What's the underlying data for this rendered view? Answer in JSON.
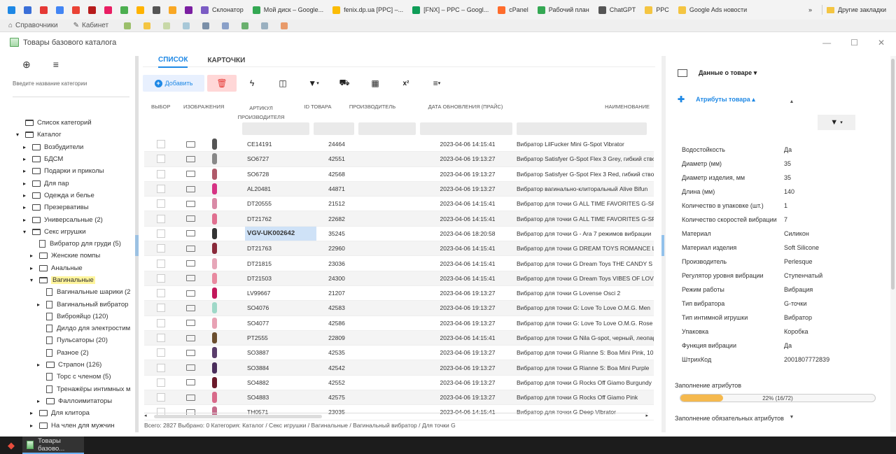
{
  "bookmarks": [
    {
      "label": "Склонатор",
      "color": "#7b5cc4"
    },
    {
      "label": "Мой диск – Google...",
      "color": "#34a853"
    },
    {
      "label": "fenix.dp.ua [PPC] –...",
      "color": "#fbbc05"
    },
    {
      "label": "[FNX] – PPC – Googl...",
      "color": "#0f9d58"
    },
    {
      "label": "cPanel",
      "color": "#ff6c2c"
    },
    {
      "label": "Рабочий план",
      "color": "#34a853"
    },
    {
      "label": "ChatGPT",
      "color": "#555555"
    },
    {
      "label": "PPC",
      "color": "#f4c542"
    },
    {
      "label": "Google Ads новости",
      "color": "#f4c542"
    }
  ],
  "bookmarks_more": "»",
  "bookmarks_other": "Другие закладки",
  "appnav": {
    "ref": "Справочники",
    "cabinet": "Кабинет"
  },
  "window_title": "Товары базового каталога",
  "left": {
    "search_placeholder": "Введите название категории",
    "tree": [
      {
        "label": "Список категорий",
        "level": 0,
        "arrow": "",
        "icon": "folder-open"
      },
      {
        "label": "Каталог",
        "level": 0,
        "arrow": "▾",
        "icon": "folder-open"
      },
      {
        "label": "Возбудители",
        "level": 1,
        "arrow": "▸",
        "icon": "folder"
      },
      {
        "label": "БДСМ",
        "level": 1,
        "arrow": "▸",
        "icon": "folder"
      },
      {
        "label": "Подарки и приколы",
        "level": 1,
        "arrow": "▸",
        "icon": "folder"
      },
      {
        "label": "Для пар",
        "level": 1,
        "arrow": "▸",
        "icon": "folder"
      },
      {
        "label": "Одежда и белье",
        "level": 1,
        "arrow": "▸",
        "icon": "folder"
      },
      {
        "label": "Презервативы",
        "level": 1,
        "arrow": "▸",
        "icon": "folder"
      },
      {
        "label": "Универсальные (2)",
        "level": 1,
        "arrow": "▸",
        "icon": "folder"
      },
      {
        "label": "Секс игрушки",
        "level": 1,
        "arrow": "▾",
        "icon": "folder-open"
      },
      {
        "label": "Вибратор для груди (5)",
        "level": 2,
        "arrow": "",
        "icon": "file"
      },
      {
        "label": "Женские помпы",
        "level": 2,
        "arrow": "▸",
        "icon": "folder"
      },
      {
        "label": "Анальные",
        "level": 2,
        "arrow": "▸",
        "icon": "folder"
      },
      {
        "label": "Вагинальные",
        "level": 2,
        "arrow": "▾",
        "icon": "folder-open",
        "highlight": true
      },
      {
        "label": "Вагинальные шарики (2",
        "level": 3,
        "arrow": "",
        "icon": "file"
      },
      {
        "label": "Вагинальный вибратор",
        "level": 3,
        "arrow": "▸",
        "icon": "file"
      },
      {
        "label": "Виброяйцо (120)",
        "level": 3,
        "arrow": "",
        "icon": "file"
      },
      {
        "label": "Дилдо для электростим",
        "level": 3,
        "arrow": "",
        "icon": "file"
      },
      {
        "label": "Пульсаторы (20)",
        "level": 3,
        "arrow": "",
        "icon": "file"
      },
      {
        "label": "Разное (2)",
        "level": 3,
        "arrow": "",
        "icon": "file"
      },
      {
        "label": "Страпон (126)",
        "level": 3,
        "arrow": "▸",
        "icon": "folder"
      },
      {
        "label": "Торс с членом (5)",
        "level": 3,
        "arrow": "",
        "icon": "file"
      },
      {
        "label": "Тренажёры интимных м",
        "level": 3,
        "arrow": "",
        "icon": "file"
      },
      {
        "label": "Фаллоимитаторы",
        "level": 3,
        "arrow": "▸",
        "icon": "folder"
      },
      {
        "label": "Для клитора",
        "level": 2,
        "arrow": "▸",
        "icon": "folder"
      },
      {
        "label": "На член для мужчин",
        "level": 2,
        "arrow": "▸",
        "icon": "folder"
      },
      {
        "label": "Наборы секс игрушек (24)",
        "level": 2,
        "arrow": "",
        "icon": "file"
      }
    ]
  },
  "tabs": {
    "list": "СПИСОК",
    "cards": "КАРТОЧКИ"
  },
  "toolbar": {
    "add": "Добавить",
    "superscript": "x²"
  },
  "columns": {
    "select": "ВЫБОР",
    "image": "ИЗОБРАЖЕНИЯ",
    "article": "АРТИКУЛ ПРОИЗВОДИТЕЛЯ",
    "id": "ID ТОВАРА",
    "maker": "ПРОИЗВОДИТЕЛЬ",
    "date": "ДАТА ОБНОВЛЕНИЯ (ПРАЙС)",
    "name": "НАИМЕНОВАНИЕ"
  },
  "rows": [
    {
      "art": "CE14191",
      "id": "24464",
      "date": "2023-04-06 14:15:41",
      "name": "Вибратор LilFucker Mini G-Spot Vibrator",
      "img": "#555555"
    },
    {
      "art": "SO6727",
      "id": "42551",
      "date": "2023-04-06 19:13:27",
      "name": "Вибратор Satisfyer G-Spot Flex 3 Grey, гибкий ствол",
      "img": "#888888"
    },
    {
      "art": "SO6728",
      "id": "42568",
      "date": "2023-04-06 19:13:27",
      "name": "Вибратор Satisfyer G-Spot Flex 3 Red, гибкий ствол",
      "img": "#b05a6a"
    },
    {
      "art": "AL20481",
      "id": "44871",
      "date": "2023-04-06 19:13:27",
      "name": "Вибратор вагинально-клиторальный Alive Bifun",
      "img": "#d63384"
    },
    {
      "art": "DT20555",
      "id": "21512",
      "date": "2023-04-06 14:15:41",
      "name": "Вибратор для точки G ALL TIME FAVORITES G-SPOT",
      "img": "#d98aa6"
    },
    {
      "art": "DT21762",
      "id": "22682",
      "date": "2023-04-06 14:15:41",
      "name": "Вибратор для точки G ALL TIME FAVORITES G-SPOT",
      "img": "#e07090"
    },
    {
      "art": "VGV-UK002642",
      "id": "35245",
      "date": "2023-04-06 18:20:58",
      "name": "Вибратор для точки G - Ara 7 режимов вибрации",
      "img": "#333333",
      "selected": true
    },
    {
      "art": "DT21763",
      "id": "22960",
      "date": "2023-04-06 14:15:41",
      "name": "Вибратор для точки G DREAM TOYS ROMANCE L",
      "img": "#8a2a3a"
    },
    {
      "art": "DT21815",
      "id": "23036",
      "date": "2023-04-06 14:15:41",
      "name": "Вибратор для точки G Dream Toys THE CANDY S",
      "img": "#e6a6b8"
    },
    {
      "art": "DT21503",
      "id": "24300",
      "date": "2023-04-06 14:15:41",
      "name": "Вибратор для точки G Dream Toys VIBES OF LOVE",
      "img": "#e88aa0"
    },
    {
      "art": "LV99667",
      "id": "21207",
      "date": "2023-04-06 19:13:27",
      "name": "Вибратор для точки G Lovense Osci 2",
      "img": "#c2185b"
    },
    {
      "art": "SO4076",
      "id": "42583",
      "date": "2023-04-06 19:13:27",
      "name": "Вибратор для точки G: Love To Love O.M.G. Men",
      "img": "#9fd8c8"
    },
    {
      "art": "SO4077",
      "id": "42586",
      "date": "2023-04-06 19:13:27",
      "name": "Вибратор для точки G: Love To Love O.M.G. Rose",
      "img": "#e8a2b4"
    },
    {
      "art": "PT2555",
      "id": "22809",
      "date": "2023-04-06 14:15:41",
      "name": "Вибратор для точки G Nila G-spot, черный, леопард",
      "img": "#6b4e2e"
    },
    {
      "art": "SO3887",
      "id": "42535",
      "date": "2023-04-06 19:13:27",
      "name": "Вибратор для точки G Rianne S: Boa Mini Pink, 10",
      "img": "#5a3d6b"
    },
    {
      "art": "SO3884",
      "id": "42542",
      "date": "2023-04-06 19:13:27",
      "name": "Вибратор для точки G Rianne S: Boa Mini Purple",
      "img": "#4a2d5b"
    },
    {
      "art": "SO4882",
      "id": "42552",
      "date": "2023-04-06 19:13:27",
      "name": "Вибратор для точки G Rocks Off Giamo Burgundy",
      "img": "#6b1a2a"
    },
    {
      "art": "SO4883",
      "id": "42575",
      "date": "2023-04-06 19:13:27",
      "name": "Вибратор для точки G Rocks Off Giamo Pink",
      "img": "#d86a8a"
    },
    {
      "art": "TH0571",
      "id": "23035",
      "date": "2023-04-06 14:15:41",
      "name": "Вибратор для точки G Deep Vibrator",
      "img": "#c46a8a"
    }
  ],
  "status": {
    "text": "Всего: 2827   Выбрано: 0   Категория: Каталог / Секс игрушки / Вагинальные / Вагинальный вибратор / Для точки G"
  },
  "right": {
    "product_data": "Данные о товаре",
    "attributes": "Атрибуты товара",
    "attrs": [
      {
        "k": "Водостойкость",
        "v": "Да"
      },
      {
        "k": "Диаметр (мм)",
        "v": "35"
      },
      {
        "k": "Диаметр изделия, мм",
        "v": "35"
      },
      {
        "k": "Длина (мм)",
        "v": "140"
      },
      {
        "k": "Количество в упаковке (шт.)",
        "v": "1"
      },
      {
        "k": "Количество скоростей вибрации",
        "v": "7"
      },
      {
        "k": "Материал",
        "v": "Силикон"
      },
      {
        "k": "Материал изделия",
        "v": "Soft Silicone"
      },
      {
        "k": "Производитель",
        "v": "Perlesque"
      },
      {
        "k": "Регулятор уровня вибрации",
        "v": "Ступенчатый"
      },
      {
        "k": "Режим работы",
        "v": "Вибрация"
      },
      {
        "k": "Тип вибратора",
        "v": "G-точки"
      },
      {
        "k": "Тип интимной игрушки",
        "v": "Вибратор"
      },
      {
        "k": "Упаковка",
        "v": "Коробка"
      },
      {
        "k": "Функция вибрации",
        "v": "Да"
      },
      {
        "k": "ШтрихКод",
        "v": "2001807772839"
      }
    ],
    "fill_label": "Заполнение атрибутов",
    "fill_fraction": 0.22,
    "fill_text": "22% (16/72)",
    "fill_required_label": "Заполнение обязательных атрибутов"
  },
  "taskbar": {
    "app": "Товары базово..."
  }
}
